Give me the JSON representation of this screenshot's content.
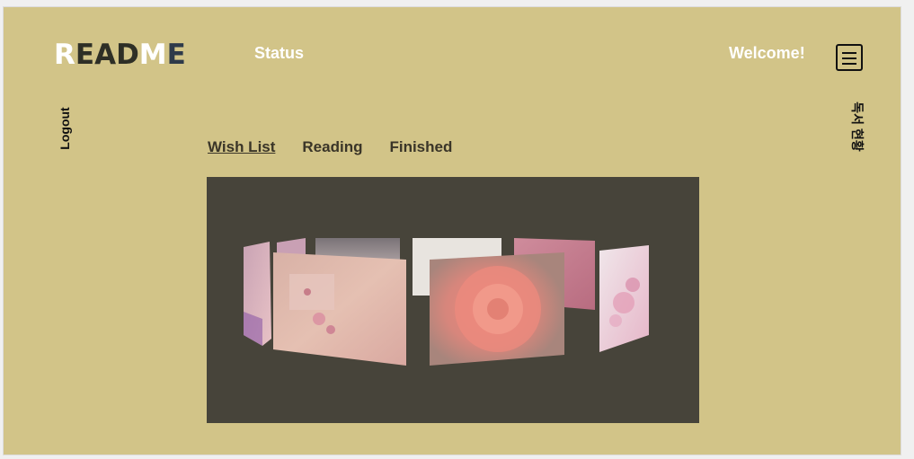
{
  "header": {
    "logo": {
      "letters": [
        {
          "char": "R",
          "color": "#ffffff"
        },
        {
          "char": "E",
          "color": "#2e2f26"
        },
        {
          "char": "A",
          "color": "#2e2f26"
        },
        {
          "char": "D",
          "color": "#2e2f26"
        },
        {
          "char": "M",
          "color": "#ffffff"
        },
        {
          "char": "E",
          "color": "#2e3a4a"
        }
      ]
    },
    "nav_status": "Status",
    "welcome": "Welcome!",
    "menu_icon": "hamburger-menu-icon"
  },
  "side": {
    "logout": "Logout",
    "reading_stats": "독서 현황"
  },
  "tabs": [
    {
      "label": "Wish List",
      "active": true
    },
    {
      "label": "Reading",
      "active": false
    },
    {
      "label": "Finished",
      "active": false
    }
  ],
  "colors": {
    "background": "#d2c488",
    "gallery_bg": "#47443a",
    "text_dark": "#3a3528",
    "white": "#ffffff"
  }
}
